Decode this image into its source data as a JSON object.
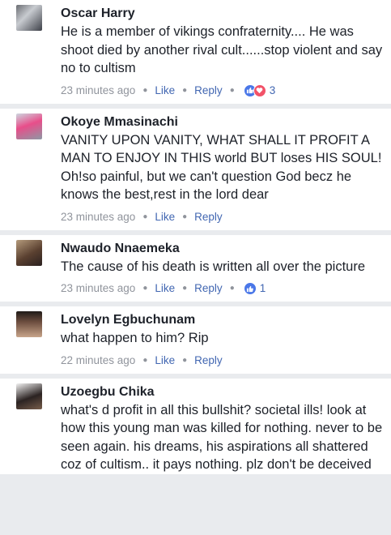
{
  "comments": [
    {
      "name": "Oscar Harry",
      "text": "He is a member of vikings confraternity.... He was shoot died by another rival cult......stop violent and say no to cultism",
      "time": "23 minutes ago",
      "like": "Like",
      "reply": "Reply",
      "reaction_count": "3"
    },
    {
      "name": "Okoye Mmasinachi",
      "text": "VANITY UPON VANITY, WHAT SHALL IT PROFIT A MAN TO ENJOY IN THIS world BUT loses HIS SOUL! Oh!so painful, but we can't question God becz he knows the best,rest in the lord dear",
      "time": "23 minutes ago",
      "like": "Like",
      "reply": "Reply"
    },
    {
      "name": "Nwaudo Nnaemeka",
      "text": "The cause of his death is written all over the picture",
      "time": "23 minutes ago",
      "like": "Like",
      "reply": "Reply",
      "reaction_count": "1"
    },
    {
      "name": "Lovelyn Egbuchunam",
      "text": "what happen to him? Rip",
      "time": "22 minutes ago",
      "like": "Like",
      "reply": "Reply"
    },
    {
      "name": "Uzoegbu Chika",
      "text": "what's d profit in all this bullshit? societal ills! look at how this young man was killed for nothing. never to be seen again. his dreams, his aspirations all shattered coz of cultism.. it pays nothing. plz don't be deceived"
    }
  ],
  "colors": {
    "link": "#4267b2",
    "meta": "#90949c",
    "like_reaction": "#4a77e8",
    "love_reaction": "#f25268"
  },
  "icons": {
    "sep": "middle-dot",
    "like": "thumbs-up-icon",
    "love": "heart-icon"
  }
}
